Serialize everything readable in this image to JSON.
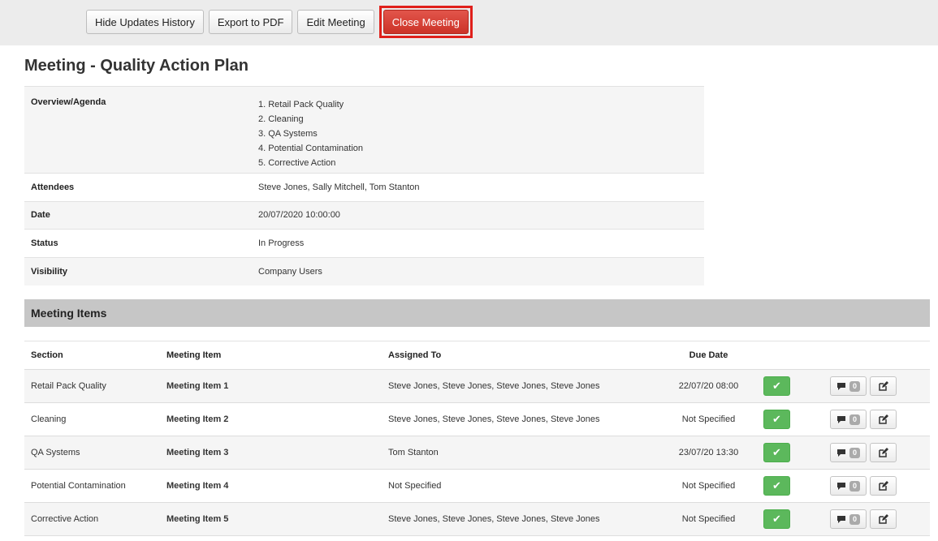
{
  "toolbar": {
    "hide_updates": "Hide Updates History",
    "export_pdf": "Export to PDF",
    "edit_meeting": "Edit Meeting",
    "close_meeting": "Close Meeting"
  },
  "title": "Meeting - Quality Action Plan",
  "details": {
    "overview_label": "Overview/Agenda",
    "agenda": [
      "1. Retail Pack Quality",
      "2. Cleaning",
      "3. QA Systems",
      "4. Potential Contamination",
      "5. Corrective Action"
    ],
    "attendees_label": "Attendees",
    "attendees": "Steve Jones, Sally Mitchell, Tom Stanton",
    "date_label": "Date",
    "date": "20/07/2020 10:00:00",
    "status_label": "Status",
    "status": "In Progress",
    "visibility_label": "Visibility",
    "visibility": "Company Users"
  },
  "meeting_items": {
    "heading": "Meeting Items",
    "columns": [
      "Section",
      "Meeting Item",
      "Assigned To",
      "Due Date"
    ],
    "rows": [
      {
        "section": "Retail Pack Quality",
        "item": "Meeting Item 1",
        "assigned": "Steve Jones, Steve Jones, Steve Jones, Steve Jones",
        "due": "22/07/20 08:00",
        "comments": "0"
      },
      {
        "section": "Cleaning",
        "item": "Meeting Item 2",
        "assigned": "Steve Jones, Steve Jones, Steve Jones, Steve Jones",
        "due": "Not Specified",
        "comments": "0"
      },
      {
        "section": "QA Systems",
        "item": "Meeting Item 3",
        "assigned": "Tom Stanton",
        "due": "23/07/20 13:30",
        "comments": "0"
      },
      {
        "section": "Potential Contamination",
        "item": "Meeting Item 4",
        "assigned": "Not Specified",
        "due": "Not Specified",
        "comments": "0"
      },
      {
        "section": "Corrective Action",
        "item": "Meeting Item 5",
        "assigned": "Steve Jones, Steve Jones, Steve Jones, Steve Jones",
        "due": "Not Specified",
        "comments": "0"
      }
    ]
  },
  "icons": {
    "complete": "check-icon",
    "comments": "comment-icon",
    "edit": "edit-icon"
  },
  "colors": {
    "close_button": "#d9443a",
    "highlight_border": "#e0201b",
    "complete_button": "#5cb85c",
    "section_bar": "#c6c6c6"
  }
}
